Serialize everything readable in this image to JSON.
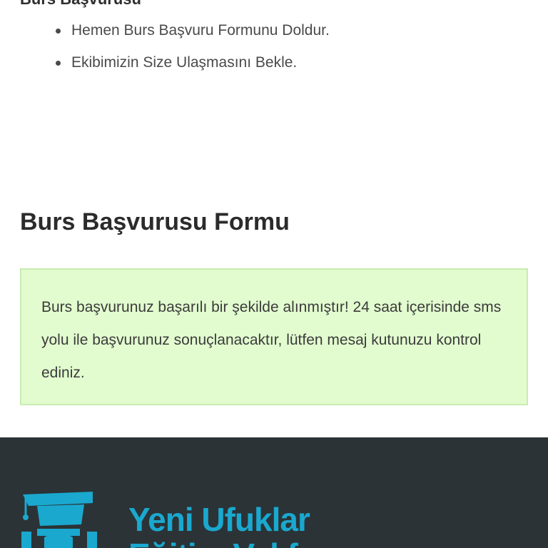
{
  "top_heading": "Burs Başvurusu",
  "steps": [
    {
      "label": "Hemen Burs Başvuru Formunu Doldur."
    },
    {
      "label": "Ekibimizin Size Ulaşmasını Bekle."
    }
  ],
  "form": {
    "title": "Burs Başvurusu Formu",
    "success_message": "Burs başvurunuz başarılı bir şekilde alınmıştır! 24 saat içerisinde sms yolu ile başvurunuz sonuçlanacaktır, lütfen mesaj kutunuzu kontrol ediniz."
  },
  "footer": {
    "logo_line1": "Yeni Ufuklar",
    "logo_line2": "Eğitim Vakfı",
    "logo_icon": "graduation-cap-icon",
    "logo_color": "#1aa8cf",
    "background_color": "#2b3336"
  },
  "colors": {
    "success_bg": "#e2fccf",
    "success_border": "#c9ecb0"
  }
}
